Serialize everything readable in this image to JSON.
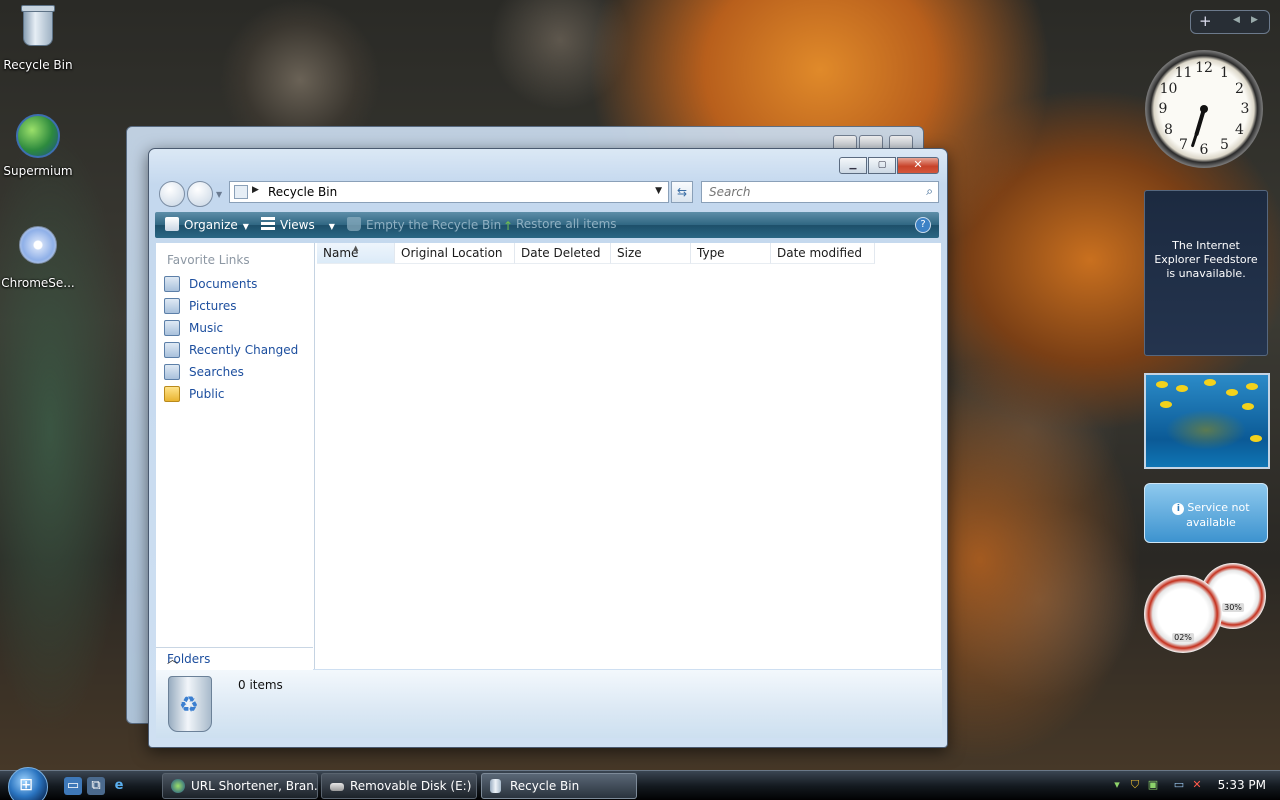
{
  "desktop": {
    "icons": [
      {
        "label": "Recycle Bin",
        "icon": "recycle-bin-icon"
      },
      {
        "label": "Supermium",
        "icon": "browser-globe-icon"
      },
      {
        "label": "ChromeSe...",
        "icon": "installer-cd-icon"
      }
    ]
  },
  "window": {
    "title": "Recycle Bin",
    "address": {
      "crumb": "Recycle Bin"
    },
    "search": {
      "placeholder": "Search"
    },
    "commands": {
      "organize": "Organize",
      "views": "Views",
      "empty": "Empty the Recycle Bin",
      "restore": "Restore all items",
      "help": "?"
    },
    "nav": {
      "header": "Favorite Links",
      "links": [
        {
          "label": "Documents",
          "icon": "documents-icon"
        },
        {
          "label": "Pictures",
          "icon": "pictures-icon"
        },
        {
          "label": "Music",
          "icon": "music-icon"
        },
        {
          "label": "Recently Changed",
          "icon": "recently-changed-icon"
        },
        {
          "label": "Searches",
          "icon": "searches-icon"
        },
        {
          "label": "Public",
          "icon": "public-folder-icon"
        }
      ],
      "folders_label": "Folders"
    },
    "columns": [
      "Name",
      "Original Location",
      "Date Deleted",
      "Size",
      "Type",
      "Date modified"
    ],
    "details": {
      "count": "0 items"
    }
  },
  "gadgets": {
    "sidebar_plus": "+",
    "clock_numbers": [
      "12",
      "1",
      "2",
      "3",
      "4",
      "5",
      "6",
      "7",
      "8",
      "9",
      "10",
      "11"
    ],
    "clock_time": {
      "hour": 6,
      "minute": 33
    },
    "feed_message": "The Internet Explorer Feedstore is unavailable.",
    "weather_message": "Service not available",
    "cpu_meter": "02%",
    "memory_meter": "30%"
  },
  "taskbar": {
    "buttons": [
      {
        "label": "URL Shortener, Bran...",
        "icon": "browser-icon"
      },
      {
        "label": "Removable Disk (E:)",
        "icon": "drive-icon"
      },
      {
        "label": "Recycle Bin",
        "icon": "recycle-bin-icon",
        "active": true
      }
    ],
    "clock": "5:33 PM"
  },
  "colors": {
    "link": "#1c4e9e",
    "command_bar": "#2f6682",
    "close_button": "#c8432a"
  }
}
